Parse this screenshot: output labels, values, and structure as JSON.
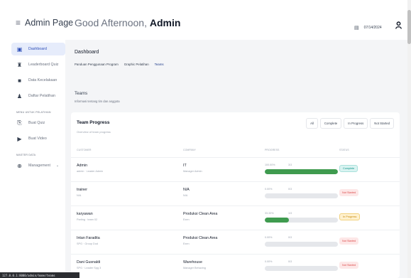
{
  "header": {
    "brand": "Admin Page",
    "greeting_prefix": "Good Afternoon,",
    "greeting_user": "Admin",
    "date": "07/14/2024"
  },
  "sidebar": {
    "items": [
      {
        "label": "Dashboard",
        "icon": "dashboard-icon",
        "active": true
      },
      {
        "label": "Leaderboard Quiz",
        "icon": "trophy-icon"
      },
      {
        "label": "Data Kecelakaan",
        "icon": "document-icon"
      },
      {
        "label": "Daftar Pelatihan",
        "icon": "training-icon"
      }
    ],
    "section_training": "Menu untuk pelatihan",
    "training_items": [
      {
        "label": "Buat Quiz",
        "icon": "quiz-icon"
      },
      {
        "label": "Buat Video",
        "icon": "video-icon"
      }
    ],
    "section_master": "Master Data",
    "master_items": [
      {
        "label": "Management",
        "icon": "management-icon"
      }
    ]
  },
  "main": {
    "title": "Dashboard",
    "subnav": [
      "Panduan Penggunaan Program",
      "Graphic Pelatihan",
      "Teams"
    ],
    "teams_title": "Teams",
    "teams_desc": "Informasi tentang tim dan anggota"
  },
  "card": {
    "title": "Team Progress",
    "subtitle": "Overview of team progress",
    "filters": [
      "All",
      "Complete",
      "In Progress",
      "Not Started"
    ],
    "columns": [
      "Customer",
      "Company",
      "Progress",
      "Status"
    ],
    "rows": [
      {
        "name": "Admin",
        "role": "admin · Leader Admin",
        "company": "IT",
        "company_sub": "Manager Admin",
        "pct": "100.00%",
        "count": "3/3",
        "progress": 1.0,
        "status": "Complete",
        "status_type": "complete"
      },
      {
        "name": "trainer",
        "role": "N/A",
        "company": "N/A",
        "company_sub": "N/A",
        "pct": "0.00%",
        "count": "0/3",
        "progress": 0.0,
        "status": "Not Started",
        "status_type": "notstarted"
      },
      {
        "name": "karyawan",
        "role": "Parting · team 02",
        "company": "Produksi Clean Area",
        "company_sub": "Exen",
        "pct": "33.33%",
        "count": "1/3",
        "progress": 0.3333,
        "status": "In Progress",
        "status_type": "progress"
      },
      {
        "name": "Intan Faradita",
        "role": "SPG · Group Dud",
        "company": "Produksi Clean Area",
        "company_sub": "Exen",
        "pct": "0.00%",
        "count": "0/3",
        "progress": 0.0,
        "status": "Not Started",
        "status_type": "notstarted"
      },
      {
        "name": "Dani Gusnaldi",
        "role": "SPG · Leader Spg 3",
        "company": "Warehouse",
        "company_sub": "Manager Behaving",
        "pct": "0.00%",
        "count": "0/3",
        "progress": 0.0,
        "status": "Not Started",
        "status_type": "notstarted"
      }
    ]
  },
  "statusbar": {
    "url": "127.0.0.1:8000/admin/home/teams"
  }
}
